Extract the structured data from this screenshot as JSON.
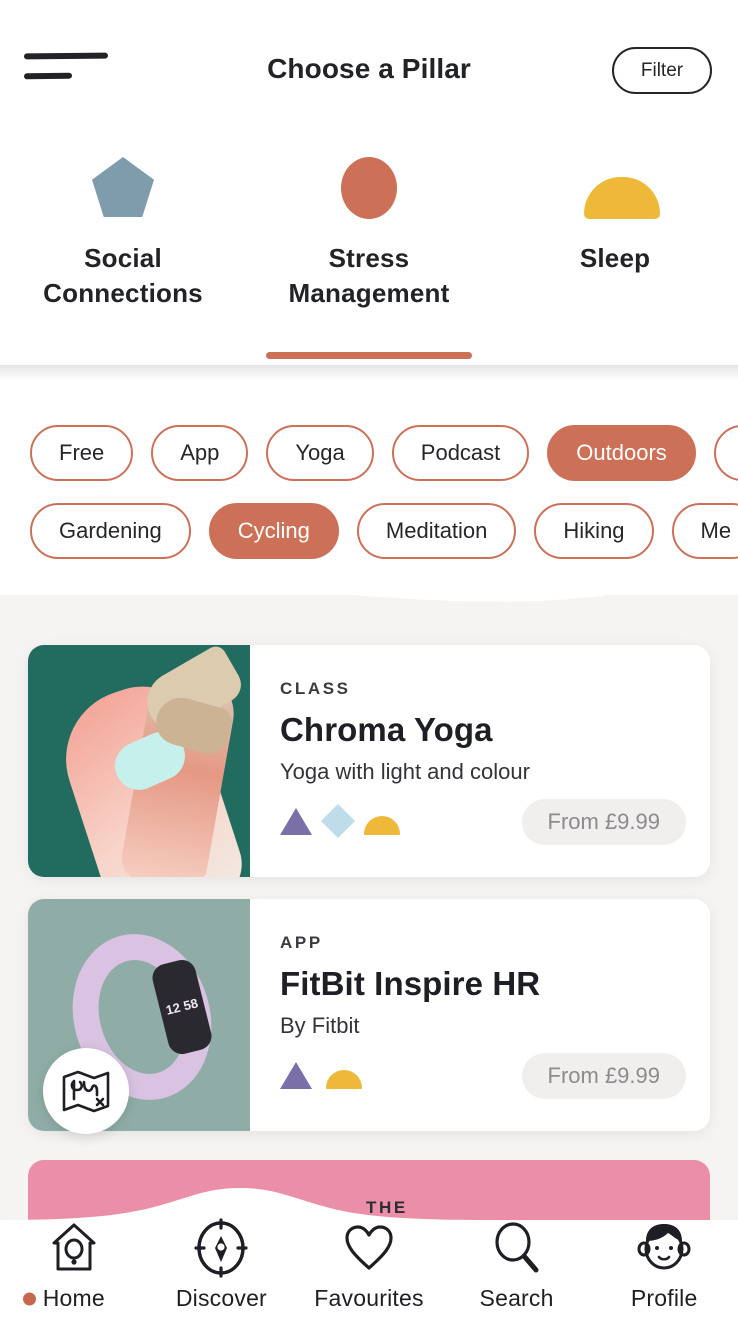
{
  "header": {
    "menu_icon": "hamburger-icon",
    "title": "Choose a Pillar",
    "filter_label": "Filter"
  },
  "pillars": {
    "items": [
      {
        "label": "Social Connections",
        "shape": "pentagon",
        "color": "#7e9cab",
        "active": false
      },
      {
        "label": "Stress Management",
        "shape": "circle",
        "color": "#cc7058",
        "active": true
      },
      {
        "label": "Sleep",
        "shape": "dome",
        "color": "#eeb938",
        "active": false
      }
    ]
  },
  "chips": {
    "row1": [
      {
        "label": "Free",
        "selected": false
      },
      {
        "label": "App",
        "selected": false
      },
      {
        "label": "Yoga",
        "selected": false
      },
      {
        "label": "Podcast",
        "selected": false
      },
      {
        "label": "Outdoors",
        "selected": true
      },
      {
        "label": "",
        "selected": false
      }
    ],
    "row2": [
      {
        "label": "Gardening",
        "selected": false
      },
      {
        "label": "Cycling",
        "selected": true
      },
      {
        "label": "Meditation",
        "selected": false
      },
      {
        "label": "Hiking",
        "selected": false
      },
      {
        "label": "Me",
        "selected": false
      }
    ]
  },
  "cards": [
    {
      "eyebrow": "CLASS",
      "title": "Chroma Yoga",
      "subtitle": "Yoga with light and colour",
      "price": "From £9.99",
      "shapes": [
        "triangle",
        "diamond",
        "dome"
      ],
      "image_alt": "legs-on-teal-background"
    },
    {
      "eyebrow": "APP",
      "title": "FitBit Inspire HR",
      "subtitle": "By Fitbit",
      "price": "From £9.99",
      "shapes": [
        "triangle",
        "dome"
      ],
      "image_alt": "lavender-fitness-tracker",
      "device_time": "12 58"
    }
  ],
  "peek_card": {
    "eyebrow": "THE",
    "color": "#eb8fa9"
  },
  "map_button": {
    "icon": "map-icon"
  },
  "bottom_nav": {
    "items": [
      {
        "label": "Home",
        "icon": "birdhouse-icon",
        "active": true
      },
      {
        "label": "Discover",
        "icon": "compass-icon",
        "active": false
      },
      {
        "label": "Favourites",
        "icon": "heart-icon",
        "active": false
      },
      {
        "label": "Search",
        "icon": "magnifier-icon",
        "active": false
      },
      {
        "label": "Profile",
        "icon": "face-icon",
        "active": false
      }
    ]
  },
  "colors": {
    "accent": "#cc7058",
    "background": "#f6f4f2",
    "text": "#222327",
    "pillar_social": "#7e9cab",
    "pillar_stress": "#cc7058",
    "pillar_sleep": "#eeb938",
    "shape_triangle": "#7b6fa8",
    "shape_diamond": "#bedce9",
    "shape_dome": "#eeb938",
    "peek_pink": "#eb8fa9"
  }
}
